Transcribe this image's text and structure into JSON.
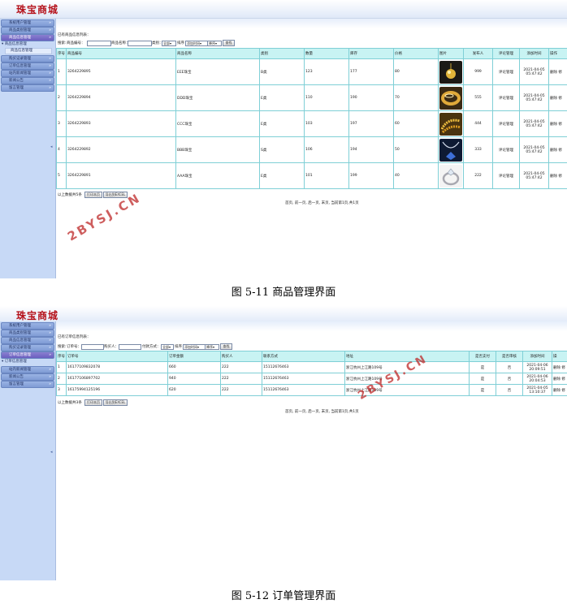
{
  "app": {
    "title": "珠宝商城"
  },
  "sidebar_menu": [
    "系统用户管理",
    "商品类别管理",
    "商品信息管理",
    "购买记录管理",
    "订单信息管理",
    "站内新闻管理",
    "新闻公告",
    "留言管理"
  ],
  "figure1": {
    "sub_head": "商品信息管理",
    "sub_item": "商品信息管理",
    "list_title": "已有商品信息列表：",
    "search": {
      "label_search": "搜索:",
      "label_no": "商品编号：",
      "label_name": "商品名称：",
      "label_attr": "类别：",
      "attr_value": "全部",
      "label_sort": "排序",
      "sort_value": "添加时间",
      "order_value": "降序",
      "button": "查找"
    },
    "columns": [
      "序号",
      "商品编号",
      "商品名称",
      "类别",
      "数量",
      "库存",
      "价格",
      "图片",
      "发布人",
      "评论管理",
      "添加时间",
      "操作"
    ],
    "rows": [
      {
        "idx": "1",
        "code": "3264229895",
        "name": "EEE珠宝",
        "cat": "B类",
        "qty": "123",
        "stock": "177",
        "price": "80",
        "publisher": "999",
        "review": "评论管理",
        "date": "2021-04-05",
        "time": "05:47:42",
        "ops": "删除 修"
      },
      {
        "idx": "2",
        "code": "3264229894",
        "name": "DDD珠宝",
        "cat": "E类",
        "qty": "110",
        "stock": "190",
        "price": "70",
        "publisher": "555",
        "review": "评论管理",
        "date": "2021-04-05",
        "time": "05:47:42",
        "ops": "删除 修"
      },
      {
        "idx": "3",
        "code": "3264229893",
        "name": "CCC珠宝",
        "cat": "E类",
        "qty": "103",
        "stock": "197",
        "price": "60",
        "publisher": "444",
        "review": "评论管理",
        "date": "2021-04-05",
        "time": "05:47:42",
        "ops": "删除 修"
      },
      {
        "idx": "4",
        "code": "3264229892",
        "name": "BBB珠宝",
        "cat": "S类",
        "qty": "106",
        "stock": "194",
        "price": "50",
        "publisher": "333",
        "review": "评论管理",
        "date": "2021-04-05",
        "time": "05:47:42",
        "ops": "删除 修"
      },
      {
        "idx": "5",
        "code": "3264229891",
        "name": "AAA珠宝",
        "cat": "E类",
        "qty": "101",
        "stock": "199",
        "price": "40",
        "publisher": "222",
        "review": "评论管理",
        "date": "2021-04-05",
        "time": "05:47:42",
        "ops": "删除 修"
      }
    ],
    "footer_label": "以上数据共5条",
    "print_btn": "打印本页",
    "export_btn": "导出到EXCEL",
    "pager": "首页, 前一页, 后一页, 末页, 当前第1页,共1页",
    "caption": "图 5-11 商品管理界面"
  },
  "figure2": {
    "sub_head": "订单信息管理",
    "sub_item": "订单信息管理",
    "list_title": "已有订单信息列表：",
    "search": {
      "label_search": "搜索:",
      "label_no": "订单号：",
      "label_buyer": "购买人：",
      "label_pay": "付款方式：",
      "pay_value": "全部",
      "label_sort": "排序",
      "sort_value": "添加时间",
      "order_value": "降序",
      "button": "查找"
    },
    "columns": [
      "序号",
      "订单号",
      "订单金额",
      "购买人",
      "联系方式",
      "地址",
      "是否支付",
      "是否审核",
      "添加时间",
      "操"
    ],
    "rows": [
      {
        "idx": "1",
        "no": "16177109832078",
        "amount": "660",
        "buyer": "222",
        "phone": "15112676463",
        "addr": "浙江杭州上江路109号",
        "paid": "是",
        "audit": "否",
        "date": "2021-04-06",
        "time": "20:09:51",
        "ops": "删除 修"
      },
      {
        "idx": "2",
        "no": "16177106897702",
        "amount": "940",
        "buyer": "222",
        "phone": "15112676463",
        "addr": "浙江杭州上江路109号",
        "paid": "是",
        "audit": "否",
        "date": "2021-04-06",
        "time": "20:04:53",
        "ops": "删除 修"
      },
      {
        "idx": "3",
        "no": "16175994125196",
        "amount": "620",
        "buyer": "222",
        "phone": "15112676463",
        "addr": "浙江杭州上江路109号",
        "paid": "是",
        "audit": "否",
        "date": "2021-04-05",
        "time": "13:10:37",
        "ops": "删除 修"
      }
    ],
    "footer_label": "以上数据共3条",
    "print_btn": "打印本页",
    "export_btn": "导出到EXCEL",
    "pager": "首页, 前一页, 后一页, 末页, 当前第1页,共1页",
    "caption": "图 5-12 订单管理界面"
  },
  "watermark": "2BYSJ.CN",
  "colors": {
    "brand_red": "#b5121b",
    "sidebar": "#c7d9f6",
    "menu": "#8ea8de",
    "menu_active": "#7b6fca",
    "table_header": "#c8f3f3",
    "border": "#7fcfd6"
  },
  "thumb_icons": [
    "gold-pendant-image",
    "gold-ring-image",
    "gold-chain-image",
    "blue-gem-necklace-image",
    "diamond-ring-image"
  ]
}
